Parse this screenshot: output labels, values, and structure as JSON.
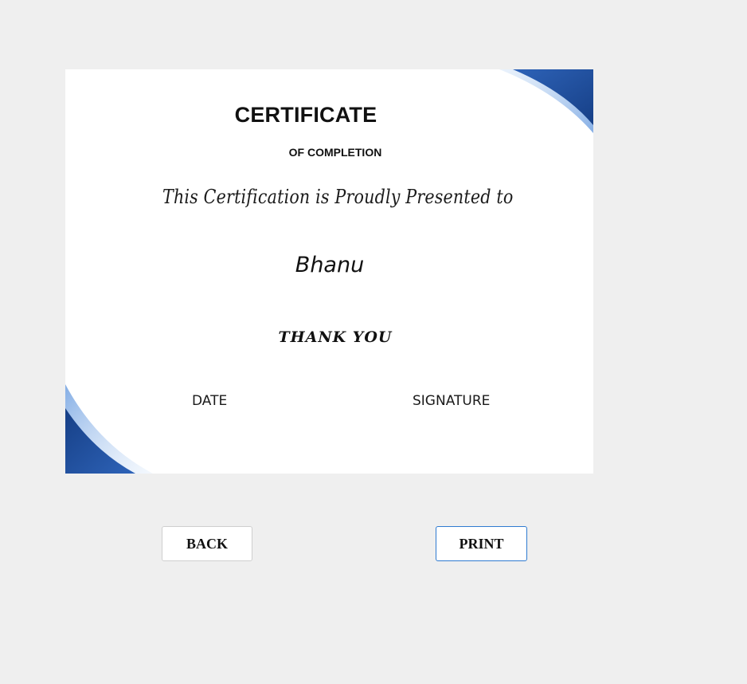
{
  "certificate": {
    "title": "CERTIFICATE",
    "subtitle": "OF COMPLETION",
    "presented_text": "This Certification is Proudly Presented to",
    "recipient_name": "Bhanu",
    "thanks_text": "THANK YOU",
    "date_label": "DATE",
    "signature_label": "SIGNATURE"
  },
  "actions": {
    "back_label": "BACK",
    "print_label": "PRINT"
  },
  "colors": {
    "page_background": "#efefef",
    "certificate_background": "#ffffff",
    "accent_dark_blue": "#1f4e9c",
    "accent_light_blue": "#9fc3f0",
    "print_border": "#2f7bd1"
  }
}
